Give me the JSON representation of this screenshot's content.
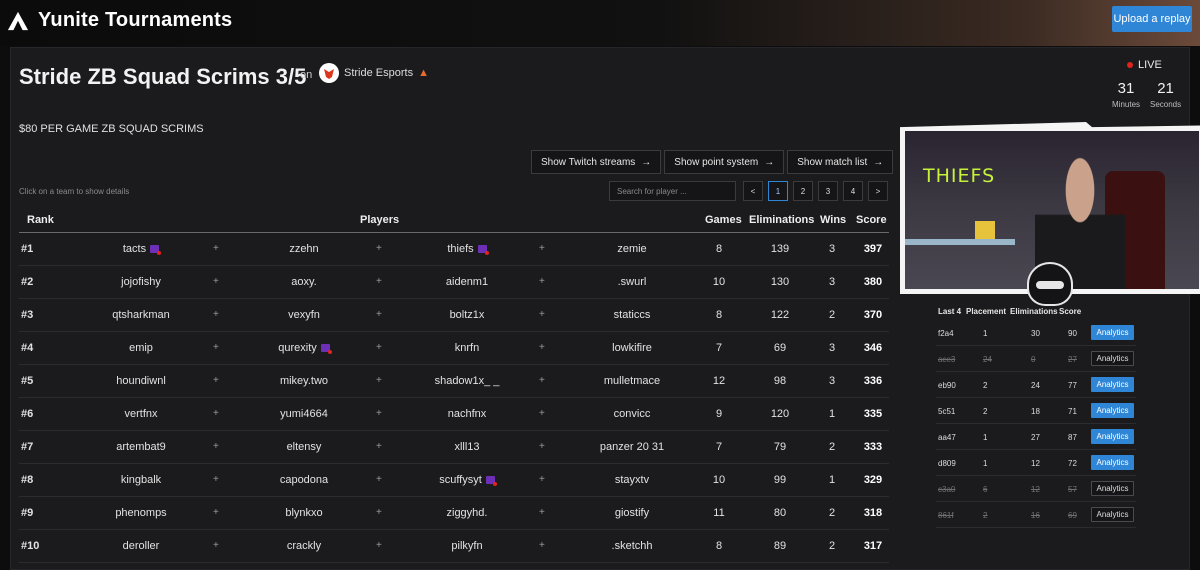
{
  "app": {
    "brand": "Yunite Tournaments",
    "upload_label": "Upload a replay"
  },
  "tournament": {
    "title": "Stride ZB Squad Scrims 3/5",
    "on_label": "on",
    "organizer": "Stride Esports",
    "description": "$80 PER GAME ZB SQUAD SCRIMS",
    "live_label": "LIVE",
    "countdown": {
      "minutes_value": "31",
      "minutes_label": "Minutes",
      "seconds_value": "21",
      "seconds_label": "Seconds"
    }
  },
  "actions": {
    "twitch": "Show Twitch streams",
    "points": "Show point system",
    "matches": "Show match list"
  },
  "hint": "Click on a team to show details",
  "search": {
    "placeholder": "Search for player ..."
  },
  "pager": {
    "prev": "<",
    "pages": [
      "1",
      "2",
      "3",
      "4"
    ],
    "next": ">",
    "active_page": "1"
  },
  "leaderboard": {
    "headers": {
      "rank": "Rank",
      "players": "Players",
      "games": "Games",
      "elims": "Eliminations",
      "wins": "Wins",
      "score": "Score"
    },
    "plus": "+",
    "rows": [
      {
        "rank": "#1",
        "p1": "tacts",
        "p2": "zzehn",
        "p3": "thiefs",
        "p4": "zemie",
        "games": "8",
        "elims": "139",
        "wins": "3",
        "score": "397"
      },
      {
        "rank": "#2",
        "p1": "jojofishy",
        "p2": "aoxy.",
        "p3": "aidenm1",
        "p4": ".swurl",
        "games": "10",
        "elims": "130",
        "wins": "3",
        "score": "380"
      },
      {
        "rank": "#3",
        "p1": "qtsharkman",
        "p2": "vexyfn",
        "p3": "boltz1x",
        "p4": "staticcs",
        "games": "8",
        "elims": "122",
        "wins": "2",
        "score": "370"
      },
      {
        "rank": "#4",
        "p1": "emip",
        "p2": "qurexity",
        "p3": "knrfn",
        "p4": "lowkifire",
        "games": "7",
        "elims": "69",
        "wins": "3",
        "score": "346"
      },
      {
        "rank": "#5",
        "p1": "houndiwnl",
        "p2": "mikey.two",
        "p3": "shadow1x_ _",
        "p4": "mulletmace",
        "games": "12",
        "elims": "98",
        "wins": "3",
        "score": "336"
      },
      {
        "rank": "#6",
        "p1": "vertfnx",
        "p2": "yumi4664",
        "p3": "nachfnx",
        "p4": "convicc",
        "games": "9",
        "elims": "120",
        "wins": "1",
        "score": "335"
      },
      {
        "rank": "#7",
        "p1": "artembat9",
        "p2": "eltensy",
        "p3": "xlll13",
        "p4": "panzer 20 31",
        "games": "7",
        "elims": "79",
        "wins": "2",
        "score": "333"
      },
      {
        "rank": "#8",
        "p1": "kingbalk",
        "p2": "capodona",
        "p3": "scuffysyt",
        "p4": "stayxtv",
        "games": "10",
        "elims": "99",
        "wins": "1",
        "score": "329"
      },
      {
        "rank": "#9",
        "p1": "phenomps",
        "p2": "blynkxo",
        "p3": "ziggyhd.",
        "p4": "giostify",
        "games": "11",
        "elims": "80",
        "wins": "2",
        "score": "318"
      },
      {
        "rank": "#10",
        "p1": "deroller",
        "p2": "crackly",
        "p3": "pilkyfn",
        "p4": ".sketchh",
        "games": "8",
        "elims": "89",
        "wins": "2",
        "score": "317"
      }
    ]
  },
  "webcam": {
    "wall_text": "THIEFS"
  },
  "team_detail": {
    "headers": {
      "last4": "Last 4",
      "placement": "Placement",
      "elims": "Eliminations",
      "score": "Score"
    },
    "button_label": "Analytics",
    "rows": [
      {
        "id": "f2a4",
        "placement": "1",
        "elims": "30",
        "score": "90",
        "counted": true
      },
      {
        "id": "ace3",
        "placement": "24",
        "elims": "0",
        "score": "27",
        "counted": false
      },
      {
        "id": "eb90",
        "placement": "2",
        "elims": "24",
        "score": "77",
        "counted": true
      },
      {
        "id": "5c51",
        "placement": "2",
        "elims": "18",
        "score": "71",
        "counted": true
      },
      {
        "id": "aa47",
        "placement": "1",
        "elims": "27",
        "score": "87",
        "counted": true
      },
      {
        "id": "d809",
        "placement": "1",
        "elims": "12",
        "score": "72",
        "counted": true
      },
      {
        "id": "c3a0",
        "placement": "6",
        "elims": "12",
        "score": "57",
        "counted": false
      },
      {
        "id": "861f",
        "placement": "2",
        "elims": "16",
        "score": "69",
        "counted": false
      }
    ]
  }
}
